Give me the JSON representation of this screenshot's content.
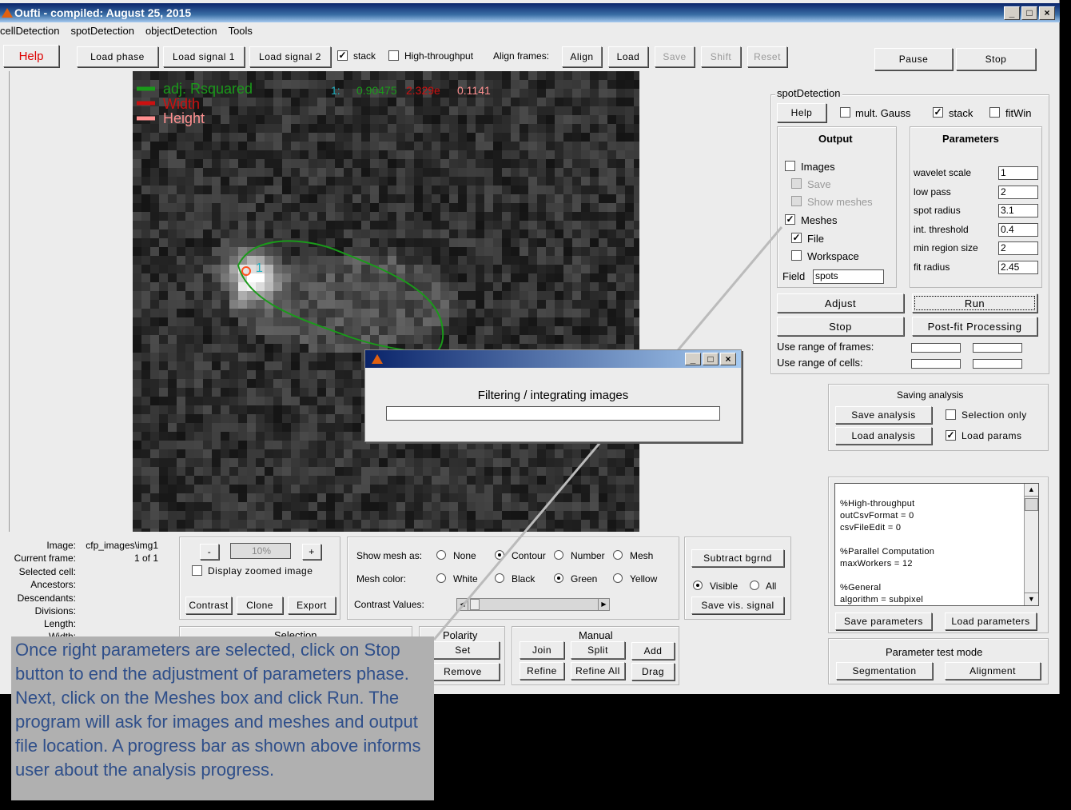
{
  "window": {
    "title": "Oufti - compiled:  August 25, 2015"
  },
  "menu": [
    "cellDetection",
    "spotDetection",
    "objectDetection",
    "Tools"
  ],
  "toolbar": {
    "help": "Help",
    "load_phase": "Load phase",
    "load_signal1": "Load signal 1",
    "load_signal2": "Load signal 2",
    "stack": "stack",
    "high_throughput": "High-throughput",
    "align_frames": "Align frames:",
    "align": "Align",
    "load": "Load",
    "save": "Save",
    "shift": "Shift",
    "reset": "Reset",
    "pause": "Pause",
    "stop": "Stop"
  },
  "legend": {
    "adj_rsq": "adj. Rsquared",
    "width": "Width",
    "height": "Height",
    "readout_index": "1:",
    "readout_v1": "0.90475",
    "readout_v2": "2.329e",
    "readout_v3": "0.1141",
    "marker_label": "1"
  },
  "spot": {
    "title": "spotDetection",
    "help": "Help",
    "mult_gauss": "mult. Gauss",
    "stack": "stack",
    "fitwin": "fitWin",
    "output": {
      "title": "Output",
      "images": "Images",
      "save": "Save",
      "show_meshes": "Show meshes",
      "meshes": "Meshes",
      "file": "File",
      "workspace": "Workspace",
      "field_label": "Field",
      "field_value": "spots"
    },
    "params": {
      "title": "Parameters",
      "rows": [
        {
          "label": "wavelet scale",
          "value": "1"
        },
        {
          "label": "low pass",
          "value": "2"
        },
        {
          "label": "spot radius",
          "value": "3.1"
        },
        {
          "label": "int. threshold",
          "value": "0.4"
        },
        {
          "label": "min region size",
          "value": "2"
        },
        {
          "label": "fit radius",
          "value": "2.45"
        }
      ]
    },
    "adjust": "Adjust",
    "run": "Run",
    "stop": "Stop",
    "postfit": "Post-fit Processing",
    "range_frames": "Use range of frames:",
    "range_cells": "Use range of cells:"
  },
  "saving": {
    "title": "Saving analysis",
    "save_analysis": "Save analysis",
    "selection_only": "Selection only",
    "load_analysis": "Load analysis",
    "load_params": "Load params"
  },
  "params_text": [
    "%High-throughput",
    "outCsvFormat = 0",
    "csvFileEdit = 0",
    "",
    "%Parallel Computation",
    "maxWorkers = 12",
    "",
    "%General",
    "algorithm = subpixel"
  ],
  "params_buttons": {
    "save": "Save parameters",
    "load": "Load parameters"
  },
  "test_mode": {
    "title": "Parameter test mode",
    "segmentation": "Segmentation",
    "alignment": "Alignment"
  },
  "info": {
    "image_label": "Image:",
    "image_value": "cfp_images\\img1",
    "frame_label": "Current frame:",
    "frame_value": "1 of 1",
    "selected_label": "Selected cell:",
    "ancestors_label": "Ancestors:",
    "descendants_label": "Descendants:",
    "divisions_label": "Divisions:",
    "length_label": "Length:",
    "width_label": "Width:"
  },
  "zoom": {
    "minus": "-",
    "value": "10%",
    "plus": "+",
    "display_zoomed": "Display zoomed image",
    "contrast": "Contrast",
    "clone": "Clone",
    "export": "Export"
  },
  "mesh": {
    "show_label": "Show mesh as:",
    "none": "None",
    "contour": "Contour",
    "number": "Number",
    "mesh": "Mesh",
    "color_label": "Mesh color:",
    "white": "White",
    "black": "Black",
    "green": "Green",
    "yellow": "Yellow",
    "contrast_label": "Contrast Values:"
  },
  "bgrnd": {
    "subtract": "Subtract bgrnd",
    "visible": "Visible",
    "all": "All",
    "save_vis": "Save vis. signal"
  },
  "selection": {
    "title": "Selection"
  },
  "polarity": {
    "title": "Polarity",
    "set": "Set",
    "remove": "Remove"
  },
  "manual": {
    "title": "Manual",
    "join": "Join",
    "split": "Split",
    "add": "Add",
    "refine": "Refine",
    "refine_all": "Refine All",
    "drag": "Drag"
  },
  "dialog": {
    "message": "Filtering / integrating images"
  },
  "annotation": "Once right parameters are selected, click on Stop button to end the adjustment of parameters phase.   Next, click on the Meshes box  and click Run.  The program will ask for images and meshes and output file location.  A progress bar as shown above informs user about the analysis progress."
}
